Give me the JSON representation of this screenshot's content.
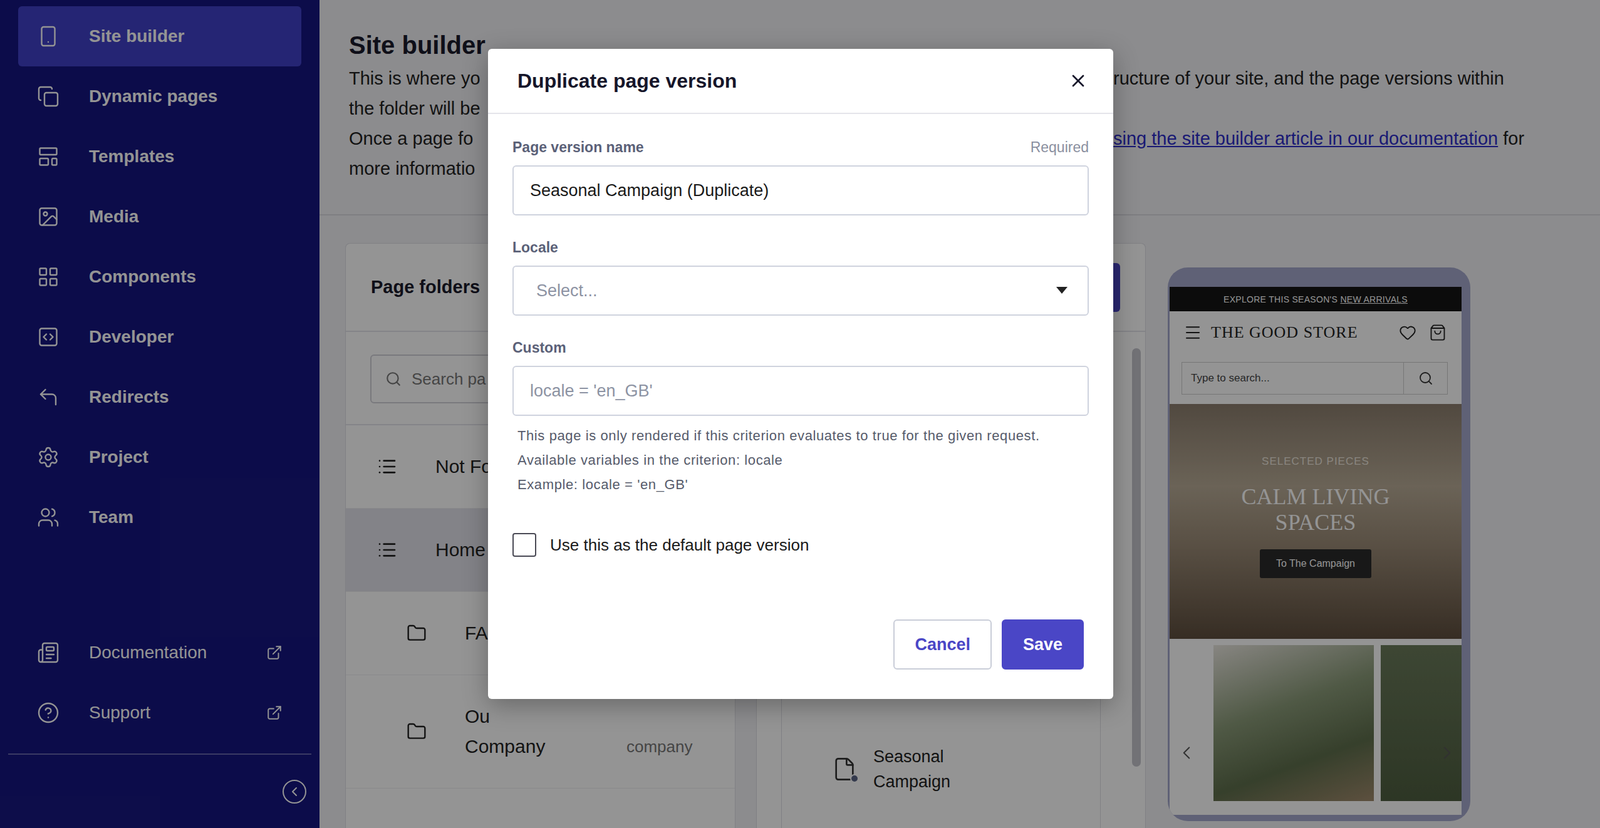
{
  "sidebar": {
    "items": [
      {
        "label": "Site builder",
        "selected": true
      },
      {
        "label": "Dynamic pages",
        "selected": false
      },
      {
        "label": "Templates",
        "selected": false
      },
      {
        "label": "Media",
        "selected": false
      },
      {
        "label": "Components",
        "selected": false
      },
      {
        "label": "Developer",
        "selected": false
      },
      {
        "label": "Redirects",
        "selected": false
      },
      {
        "label": "Project",
        "selected": false
      },
      {
        "label": "Team",
        "selected": false
      }
    ],
    "footer_links": [
      {
        "label": "Documentation",
        "external": true
      },
      {
        "label": "Support",
        "external": true
      }
    ]
  },
  "header": {
    "title": "Site builder",
    "lines": [
      {
        "left": "This is where yo",
        "right": [
          {
            "text": "ructure of your site, and the page versions within",
            "link": false
          }
        ]
      },
      {
        "left": "the folder will be",
        "right": []
      },
      {
        "left": "Once a page fo",
        "right": [
          {
            "text": "sing the site builder article in our documentation",
            "link": true
          },
          {
            "text": " for",
            "link": false
          }
        ]
      },
      {
        "left": "more informatio",
        "right": []
      }
    ]
  },
  "page_folders": {
    "title": "Page folders",
    "search_placeholder": "Search pa",
    "rows": [
      {
        "lines": [
          "Not Fo"
        ],
        "kind": "page",
        "selected": false,
        "slug": ""
      },
      {
        "lines": [
          "Home"
        ],
        "kind": "page",
        "selected": true,
        "slug": ""
      },
      {
        "lines": [
          "FA"
        ],
        "kind": "folder",
        "selected": false,
        "slug": ""
      },
      {
        "lines": [
          "Ou",
          "Company"
        ],
        "kind": "folder",
        "selected": false,
        "slug": "company"
      }
    ]
  },
  "page_versions": {
    "items": [
      {
        "label": "Seasonal Campaign"
      }
    ]
  },
  "preview": {
    "banner": {
      "text": "EXPLORE THIS SEASON'S ",
      "link": "NEW ARRIVALS"
    },
    "store_name": "THE GOOD STORE",
    "search_placeholder": "Type to search...",
    "hero": {
      "eyebrow": "SELECTED PIECES",
      "title": "CALM LIVING SPACES",
      "button": "To The Campaign"
    }
  },
  "modal": {
    "title": "Duplicate page version",
    "fields": [
      {
        "label": "Page version name",
        "note": "Required",
        "kind": "text",
        "value": "Seasonal Campaign (Duplicate)",
        "placeholder": "",
        "help": []
      },
      {
        "label": "Locale",
        "note": "",
        "kind": "select",
        "value": "",
        "placeholder": "Select...",
        "help": []
      },
      {
        "label": "Custom",
        "note": "",
        "kind": "text",
        "value": "",
        "placeholder": "locale = 'en_GB'",
        "help": [
          "This page is only rendered if this criterion evaluates to true for the given request.",
          "Available variables in the criterion: locale",
          "Example: locale = 'en_GB'"
        ]
      }
    ],
    "checkbox": {
      "label": "Use this as the default page version",
      "checked": false
    },
    "buttons": [
      {
        "label": "Cancel",
        "kind": "secondary"
      },
      {
        "label": "Save",
        "kind": "primary"
      }
    ]
  }
}
